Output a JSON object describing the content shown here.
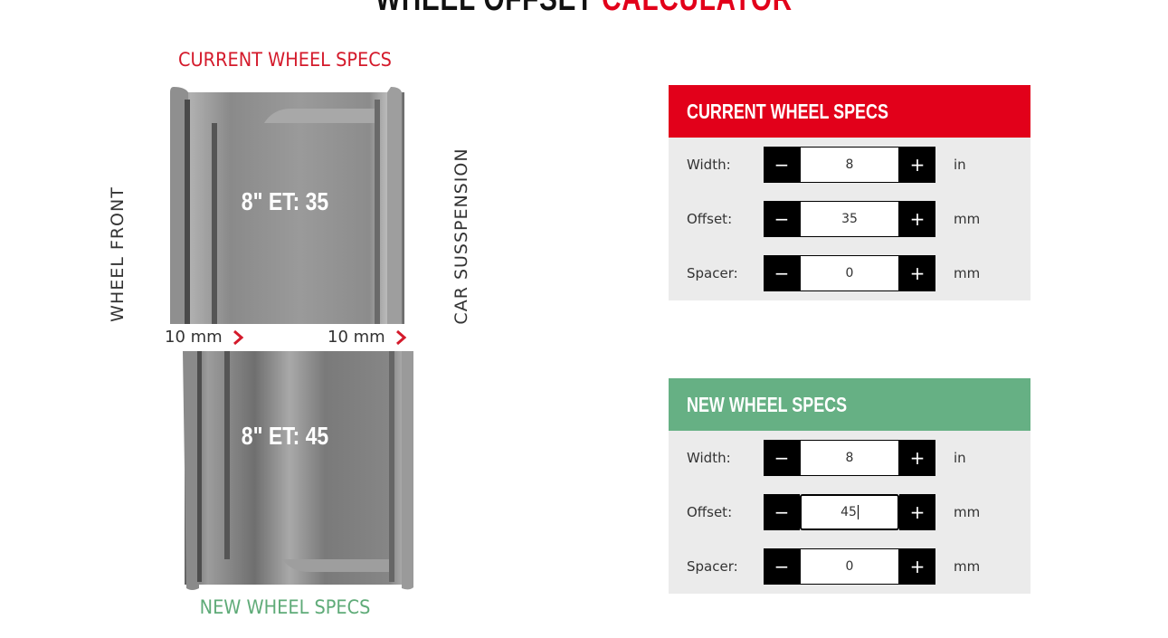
{
  "title": {
    "part1": "WHEEL OFFSET ",
    "part2": "CALCULATOR"
  },
  "diagram": {
    "current_label": "CURRENT WHEEL SPECS",
    "new_label": "NEW WHEEL SPECS",
    "side_front": "WHEEL FRONT",
    "side_car": "CAR SUSSPENSION",
    "current_spec": "8\" ET: 35",
    "new_spec": "8\" ET: 45",
    "diff_front": "10 mm",
    "diff_car": "10 mm",
    "accent_color": "#e2001a"
  },
  "current_panel": {
    "heading": "CURRENT WHEEL SPECS",
    "color": "#e2001a",
    "rows": [
      {
        "label": "Width:",
        "value": "8",
        "unit": "in",
        "minus": "−",
        "plus": "+"
      },
      {
        "label": "Offset:",
        "value": "35",
        "unit": "mm",
        "minus": "−",
        "plus": "+"
      },
      {
        "label": "Spacer:",
        "value": "0",
        "unit": "mm",
        "minus": "−",
        "plus": "+"
      }
    ]
  },
  "new_panel": {
    "heading": "NEW WHEEL SPECS",
    "color": "#66b084",
    "rows": [
      {
        "label": "Width:",
        "value": "8",
        "unit": "in",
        "minus": "−",
        "plus": "+"
      },
      {
        "label": "Offset:",
        "value": "45",
        "unit": "mm",
        "minus": "−",
        "plus": "+"
      },
      {
        "label": "Spacer:",
        "value": "0",
        "unit": "mm",
        "minus": "−",
        "plus": "+"
      }
    ]
  }
}
